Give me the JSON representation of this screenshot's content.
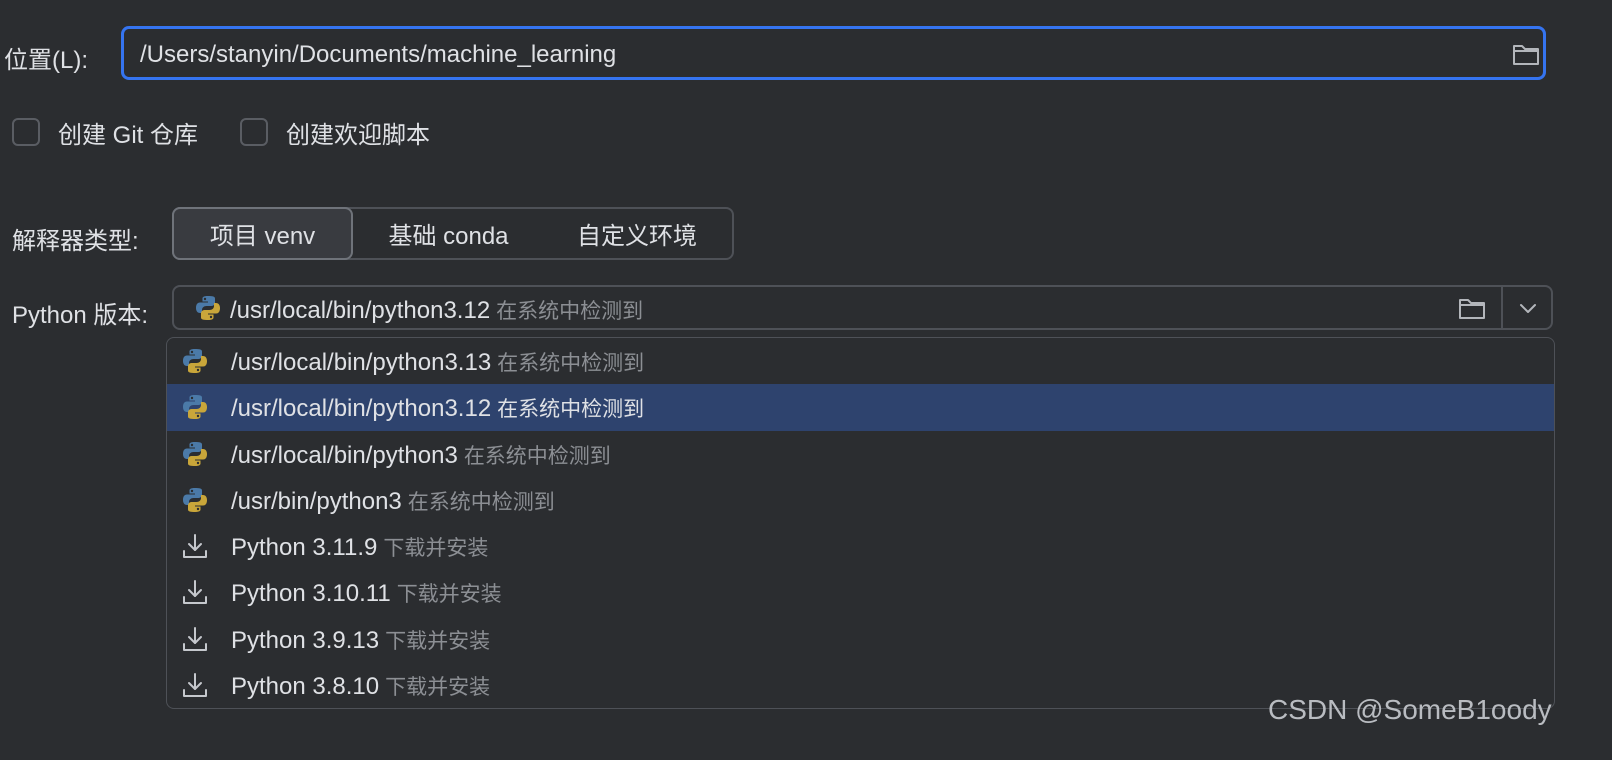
{
  "location": {
    "label": "位置(L):",
    "value": "/Users/stanyin/Documents/machine_learning",
    "browse_icon": "folder-icon"
  },
  "options": {
    "create_git": "创建 Git 仓库",
    "create_welcome": "创建欢迎脚本"
  },
  "interpreter": {
    "label": "解释器类型:",
    "tabs": [
      "项目 venv",
      "基础 conda",
      "自定义环境"
    ],
    "selected": "项目 venv"
  },
  "python_version": {
    "label": "Python 版本:",
    "value": "/usr/local/bin/python3.12",
    "hint": "在系统中检测到"
  },
  "dropdown": {
    "items": [
      {
        "icon": "python-icon",
        "text": "/usr/local/bin/python3.13",
        "hint": "在系统中检测到",
        "selected": false
      },
      {
        "icon": "python-icon",
        "text": "/usr/local/bin/python3.12",
        "hint": "在系统中检测到",
        "selected": true
      },
      {
        "icon": "python-icon",
        "text": "/usr/local/bin/python3",
        "hint": "在系统中检测到",
        "selected": false
      },
      {
        "icon": "python-icon",
        "text": "/usr/bin/python3",
        "hint": "在系统中检测到",
        "selected": false
      },
      {
        "icon": "download-icon",
        "text": "Python 3.11.9",
        "hint": "下载并安装",
        "selected": false
      },
      {
        "icon": "download-icon",
        "text": "Python 3.10.11",
        "hint": "下载并安装",
        "selected": false
      },
      {
        "icon": "download-icon",
        "text": "Python 3.9.13",
        "hint": "下载并安装",
        "selected": false
      },
      {
        "icon": "download-icon",
        "text": "Python 3.8.10",
        "hint": "下载并安装",
        "selected": false
      }
    ]
  },
  "watermark": "CSDN @SomeB1oody",
  "colors": {
    "background": "#2b2d30",
    "focus_border": "#3574f0",
    "selected_row": "#2e436e",
    "python_blue": "#4b7aa8",
    "python_yellow": "#c9a63a"
  }
}
